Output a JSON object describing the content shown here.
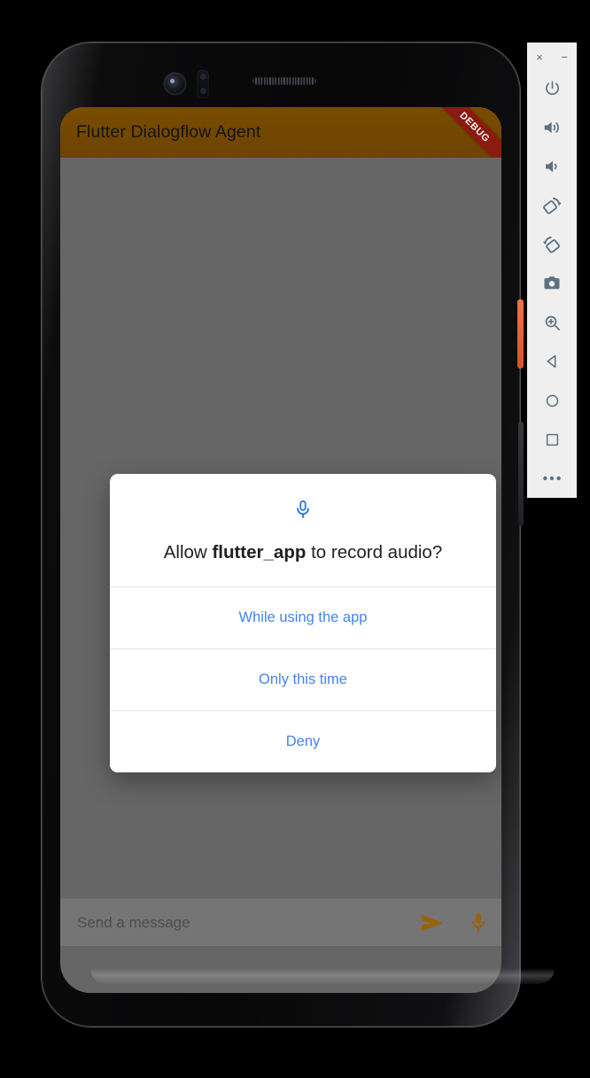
{
  "app": {
    "title": "Flutter Dialogflow Agent",
    "debug_banner": "DEBUG",
    "appbar_color": "#6d4300",
    "banner_color": "#8b1a10"
  },
  "dialog": {
    "icon": "microphone-icon",
    "icon_color": "#1a73e8",
    "message_prefix": "Allow ",
    "message_app_name": "flutter_app",
    "message_suffix": " to record audio?",
    "action_color": "#4285f4",
    "actions": [
      {
        "label": "While using the app",
        "name": "while-using-the-app"
      },
      {
        "label": "Only this time",
        "name": "only-this-time"
      },
      {
        "label": "Deny",
        "name": "deny"
      }
    ]
  },
  "composer": {
    "placeholder": "Send a message",
    "value": "",
    "send_icon": "send-icon",
    "mic_icon": "microphone-icon",
    "icon_color": "#9a6200"
  },
  "emulator_toolbar": {
    "window_controls": [
      {
        "label": "×",
        "name": "close-window-button"
      },
      {
        "label": "−",
        "name": "minimize-window-button"
      }
    ],
    "buttons": [
      {
        "name": "power-icon",
        "title": "Power"
      },
      {
        "name": "volume-up-icon",
        "title": "Volume Up"
      },
      {
        "name": "volume-down-icon",
        "title": "Volume Down"
      },
      {
        "name": "rotate-left-icon",
        "title": "Rotate Left"
      },
      {
        "name": "rotate-right-icon",
        "title": "Rotate Right"
      },
      {
        "name": "camera-icon",
        "title": "Take Screenshot"
      },
      {
        "name": "zoom-in-icon",
        "title": "Enable Zoom"
      },
      {
        "name": "back-icon",
        "title": "Back"
      },
      {
        "name": "home-icon",
        "title": "Home"
      },
      {
        "name": "overview-icon",
        "title": "Overview"
      },
      {
        "name": "more-icon",
        "title": "More"
      }
    ],
    "icon_color": "#5c7180",
    "background": "#efefef"
  },
  "device": {
    "power_button_color": "#e0572f",
    "screen_background": "#666666"
  }
}
